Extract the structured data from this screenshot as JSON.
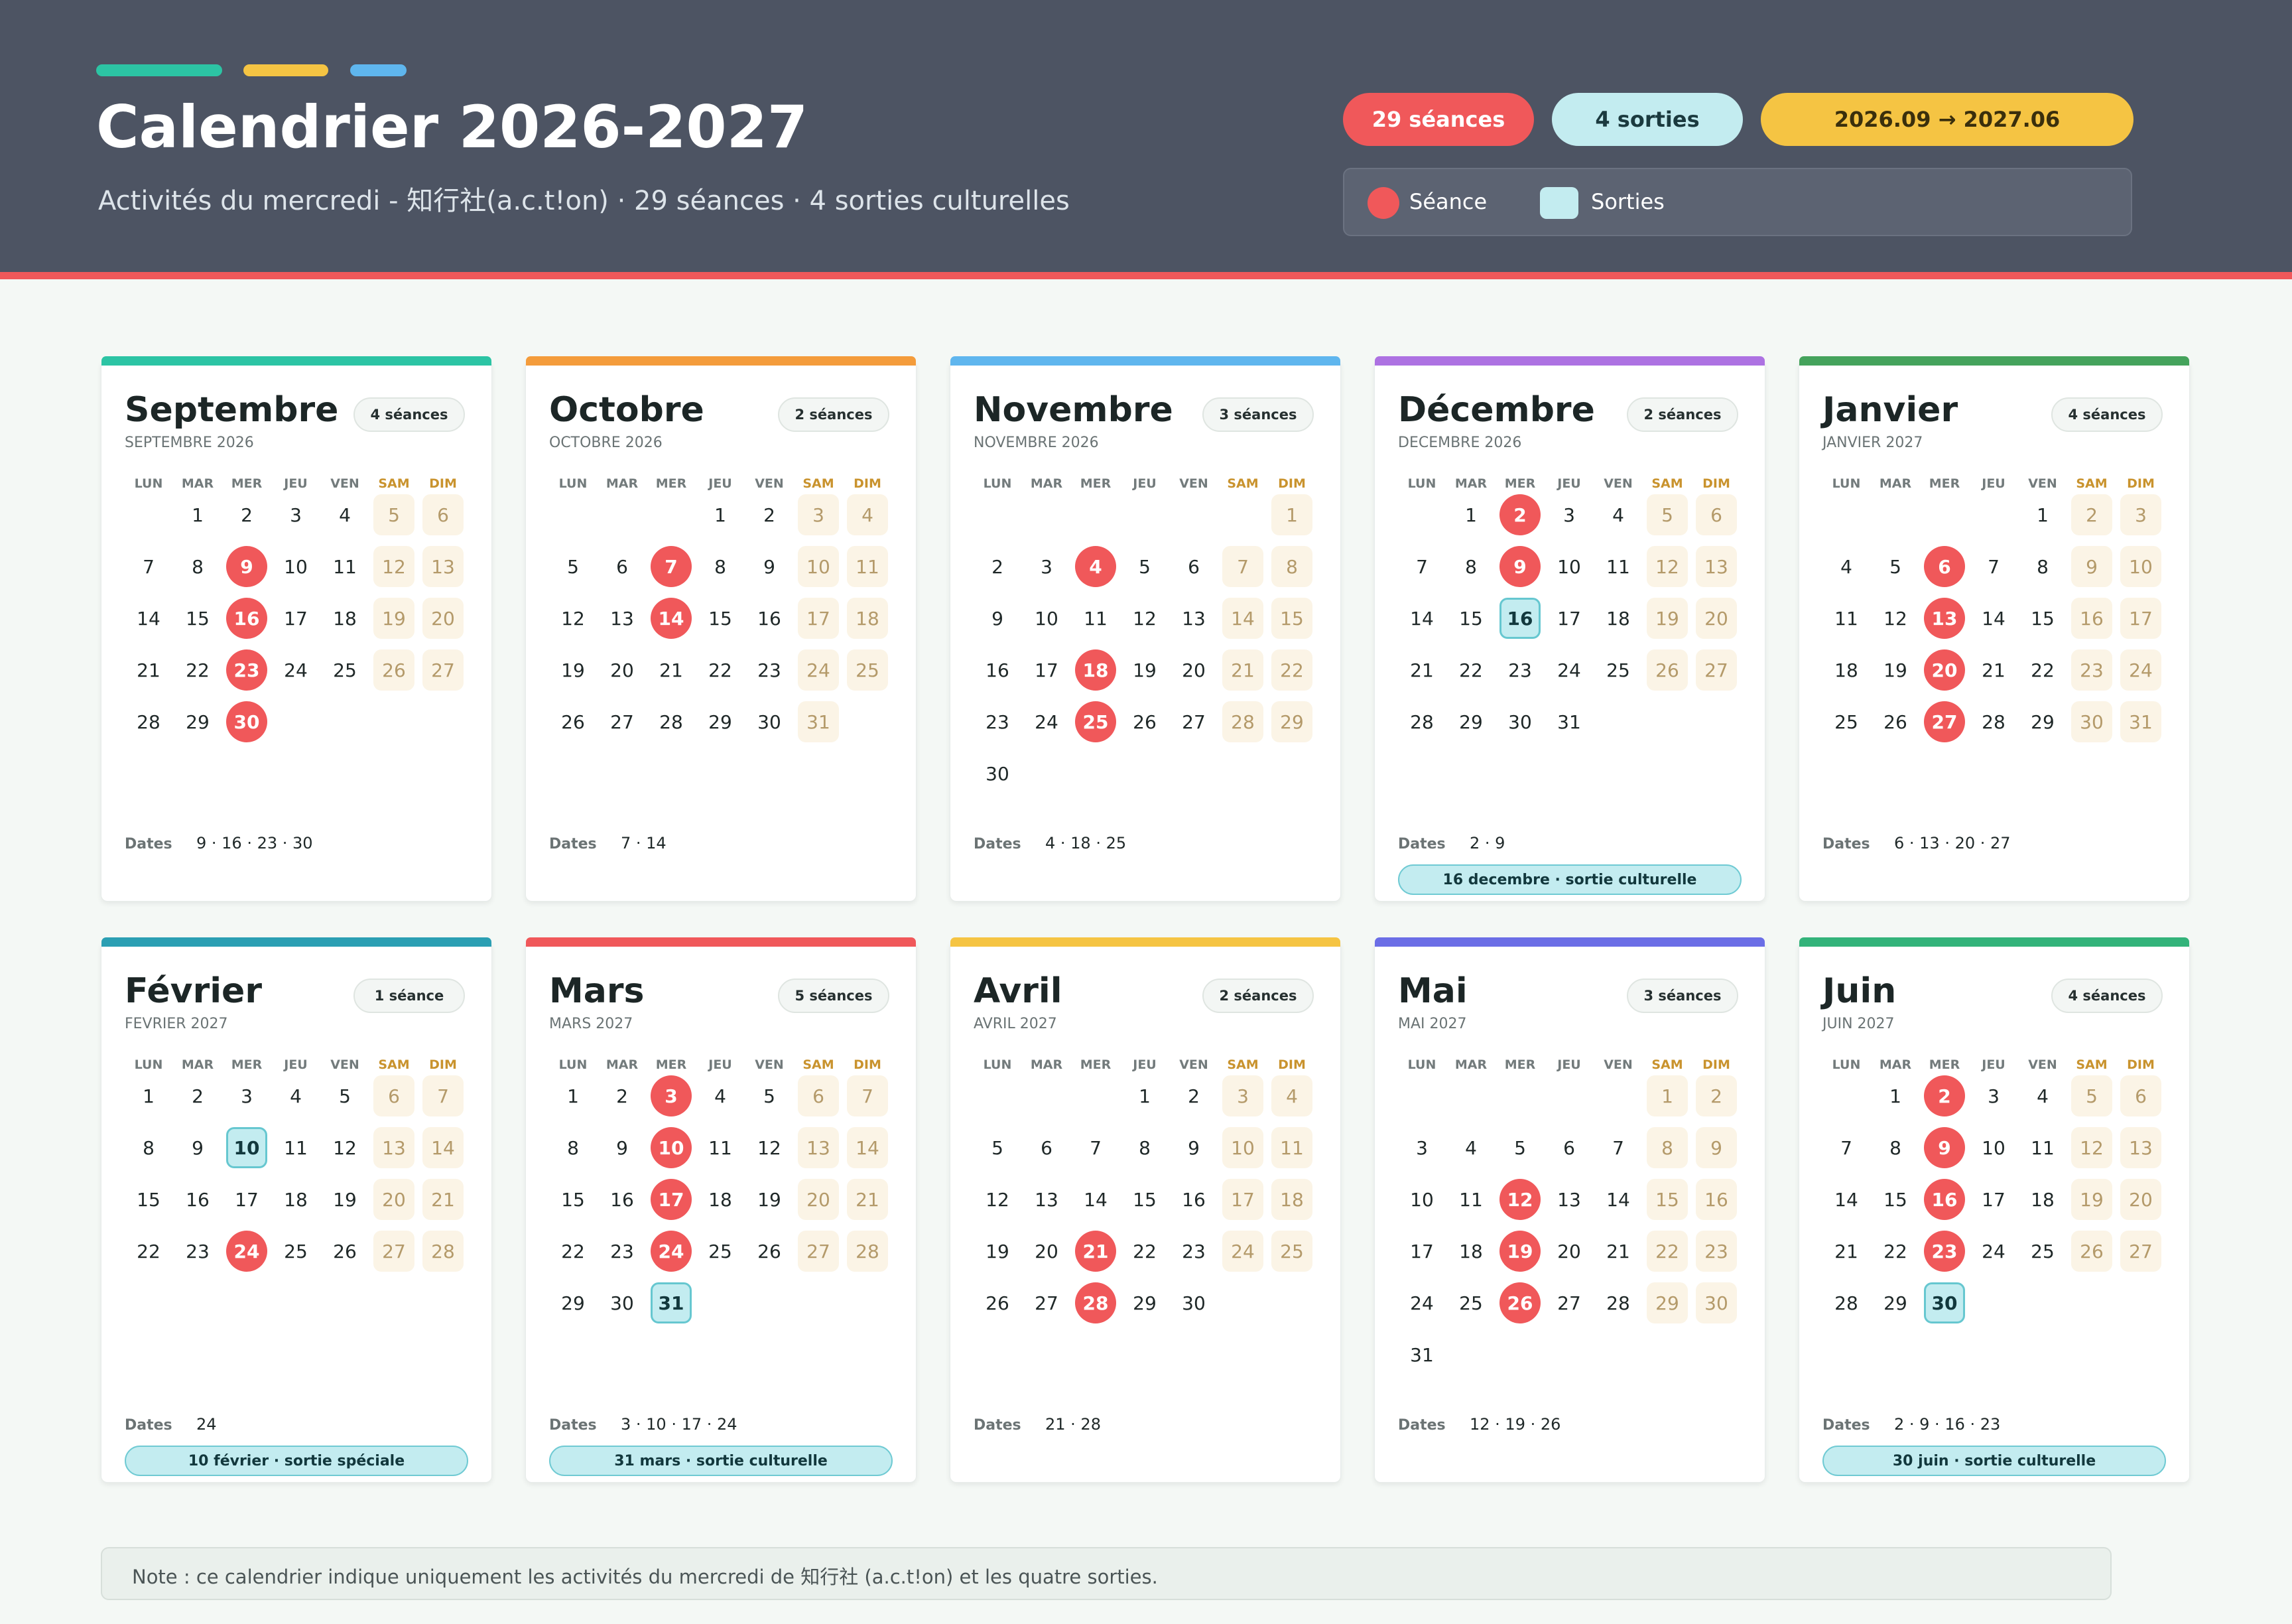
{
  "header": {
    "title": "Calendrier 2026-2027",
    "subtitle": "Activités du mercredi - 知行社(a.c.t!on) · 29 séances · 4 sorties culturelles",
    "pills": [
      {
        "label": "29 séances",
        "bg": "#f0585a",
        "fg": "#ffffff"
      },
      {
        "label": "4 sorties",
        "bg": "#c3ecf0",
        "fg": "#1b3a3f"
      },
      {
        "label": "2026.09 → 2027.06",
        "bg": "#f5c443",
        "fg": "#3a2f0c"
      }
    ],
    "legend": {
      "seance": "Séance",
      "sorties": "Sorties"
    },
    "stripes": [
      "#2cc4a4",
      "#f5c443",
      "#5fb6ee"
    ]
  },
  "weekdays": [
    "LUN",
    "MAR",
    "MER",
    "JEU",
    "VEN",
    "SAM",
    "DIM"
  ],
  "dates_label": "Dates",
  "months": [
    {
      "name": "Septembre",
      "sub": "SEPTEMBRE 2026",
      "count": "4 séances",
      "color": "#2cc4a4",
      "start": 1,
      "days": 30,
      "seances": [
        9,
        16,
        23,
        30
      ],
      "sorties": [],
      "dates": "9 · 16 · 23 · 30",
      "sortie_label": ""
    },
    {
      "name": "Octobre",
      "sub": "OCTOBRE 2026",
      "count": "2 séances",
      "color": "#f49c3b",
      "start": 3,
      "days": 31,
      "seances": [
        7,
        14
      ],
      "sorties": [],
      "dates": "7 · 14",
      "sortie_label": ""
    },
    {
      "name": "Novembre",
      "sub": "NOVEMBRE 2026",
      "count": "3 séances",
      "color": "#5fb6ee",
      "start": 6,
      "days": 30,
      "seances": [
        4,
        18,
        25
      ],
      "sorties": [],
      "dates": "4 · 18 · 25",
      "sortie_label": ""
    },
    {
      "name": "Décembre",
      "sub": "DECEMBRE 2026",
      "count": "2 séances",
      "color": "#ad72e2",
      "start": 1,
      "days": 31,
      "seances": [
        2,
        9
      ],
      "sorties": [
        16
      ],
      "dates": "2 · 9",
      "sortie_label": "16 decembre · sortie culturelle"
    },
    {
      "name": "Janvier",
      "sub": "JANVIER 2027",
      "count": "4 séances",
      "color": "#45a35c",
      "start": 4,
      "days": 31,
      "seances": [
        6,
        13,
        20,
        27
      ],
      "sorties": [],
      "dates": "6 · 13 · 20 · 27",
      "sortie_label": ""
    },
    {
      "name": "Février",
      "sub": "FEVRIER 2027",
      "count": "1 séance",
      "color": "#2b9fb3",
      "start": 0,
      "days": 28,
      "seances": [
        24
      ],
      "sorties": [
        10
      ],
      "dates": "24",
      "sortie_label": "10 février · sortie spéciale"
    },
    {
      "name": "Mars",
      "sub": "MARS 2027",
      "count": "5 séances",
      "color": "#f0585a",
      "start": 0,
      "days": 31,
      "seances": [
        3,
        10,
        17,
        24
      ],
      "sorties": [
        31
      ],
      "dates": "3 · 10 · 17 · 24",
      "sortie_label": "31 mars · sortie culturelle"
    },
    {
      "name": "Avril",
      "sub": "AVRIL 2027",
      "count": "2 séances",
      "color": "#f5c443",
      "start": 3,
      "days": 30,
      "seances": [
        21,
        28
      ],
      "sorties": [],
      "dates": "21 · 28",
      "sortie_label": ""
    },
    {
      "name": "Mai",
      "sub": "MAI 2027",
      "count": "3 séances",
      "color": "#6b6ee6",
      "start": 5,
      "days": 31,
      "seances": [
        12,
        19,
        26
      ],
      "sorties": [],
      "dates": "12 · 19 · 26",
      "sortie_label": ""
    },
    {
      "name": "Juin",
      "sub": "JUIN 2027",
      "count": "4 séances",
      "color": "#33b37a",
      "start": 1,
      "days": 30,
      "seances": [
        2,
        9,
        16,
        23
      ],
      "sorties": [
        30
      ],
      "dates": "2 · 9 · 16 · 23",
      "sortie_label": "30 juin · sortie culturelle"
    }
  ],
  "note": "Note : ce calendrier indique uniquement les activités du mercredi de 知行社 (a.c.t!on) et les quatre sorties."
}
